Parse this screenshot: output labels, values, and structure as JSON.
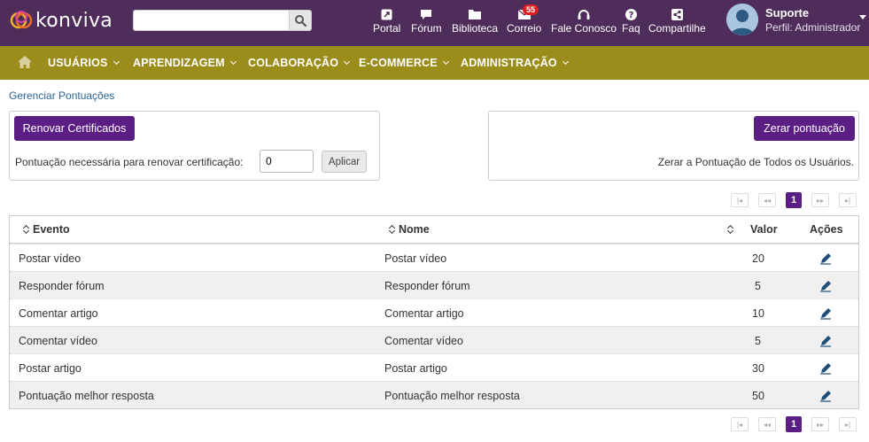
{
  "app": {
    "logo_text": "konviva",
    "brand_color": "#4f2d5a",
    "nav_color": "#9b8d1c",
    "accent_color": "#5b1e85"
  },
  "search": {
    "value": "",
    "placeholder": "",
    "icon": "search-icon"
  },
  "topnav": [
    {
      "label": "Portal",
      "icon": "portal-icon"
    },
    {
      "label": "Fórum",
      "icon": "forum-icon"
    },
    {
      "label": "Biblioteca",
      "icon": "library-icon"
    },
    {
      "label": "Correio",
      "icon": "mail-icon",
      "badge": "55"
    },
    {
      "label": "Fale Conosco",
      "icon": "headset-icon"
    },
    {
      "label": "Faq",
      "icon": "help-icon"
    },
    {
      "label": "Compartilhe",
      "icon": "share-icon"
    }
  ],
  "user": {
    "name": "Suporte",
    "role": "Perfil: Administrador"
  },
  "mainnav": [
    {
      "label": "USUÁRIOS"
    },
    {
      "label": "APRENDIZAGEM"
    },
    {
      "label": "COLABORAÇÃO"
    },
    {
      "label": "E-COMMERCE"
    },
    {
      "label": "ADMINISTRAÇÃO"
    }
  ],
  "breadcrumb": "Gerenciar Pontuações",
  "renew": {
    "button": "Renovar Certificados",
    "label": "Pontuação necessária para renovar certificação:",
    "value": "0",
    "apply": "Aplicar"
  },
  "reset": {
    "button": "Zerar pontuação",
    "description": "Zerar a Pontuação de Todos os Usuários."
  },
  "pager": {
    "first": "|◂",
    "prev": "◂◂",
    "current": "1",
    "next": "▸▸",
    "last": "▸|"
  },
  "table": {
    "headers": {
      "event": "Evento",
      "name": "Nome",
      "value": "Valor",
      "actions": "Ações"
    },
    "rows": [
      {
        "event": "Postar vídeo",
        "name": "Postar vídeo",
        "value": "20"
      },
      {
        "event": "Responder fórum",
        "name": "Responder fórum",
        "value": "5"
      },
      {
        "event": "Comentar artigo",
        "name": "Comentar artigo",
        "value": "10"
      },
      {
        "event": "Comentar vídeo",
        "name": "Comentar vídeo",
        "value": "5"
      },
      {
        "event": "Postar artigo",
        "name": "Postar artigo",
        "value": "30"
      },
      {
        "event": "Pontuação melhor resposta",
        "name": "Pontuação melhor resposta",
        "value": "50"
      }
    ]
  }
}
